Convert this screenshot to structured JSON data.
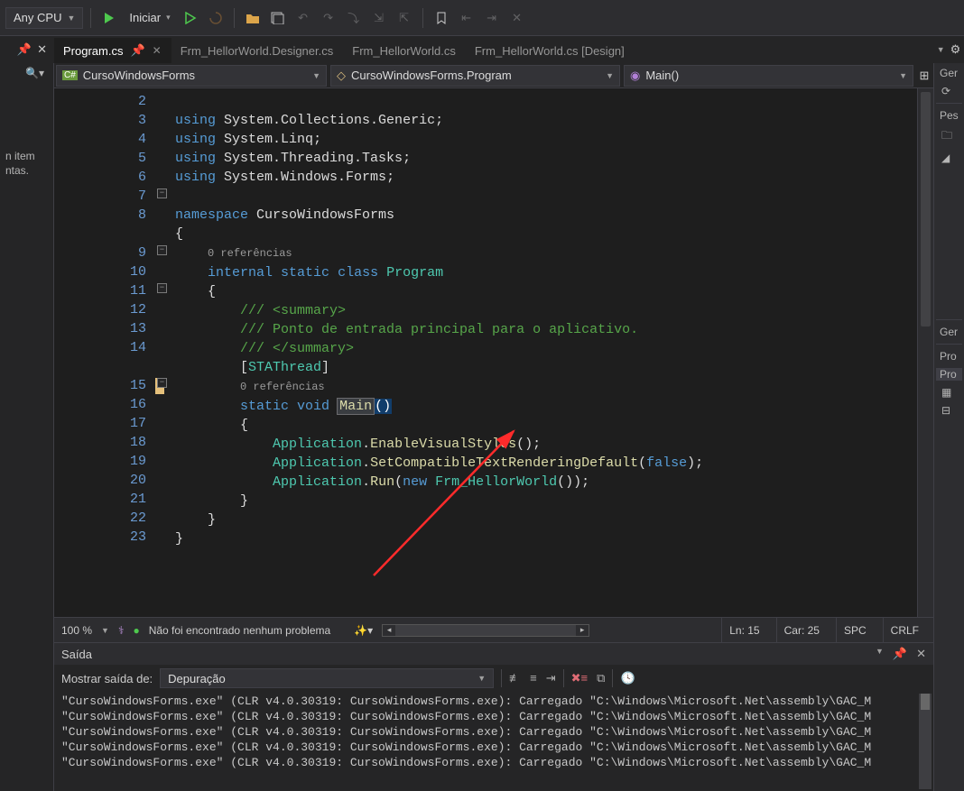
{
  "toolbar": {
    "config": "Any CPU",
    "start_label": "Iniciar"
  },
  "tabs": {
    "t0": "Program.cs",
    "t1": "Frm_HellorWorld.Designer.cs",
    "t2": "Frm_HellorWorld.cs",
    "t3": "Frm_HellorWorld.cs [Design]"
  },
  "nav": {
    "project": "CursoWindowsForms",
    "class": "CursoWindowsForms.Program",
    "member": "Main()"
  },
  "left_hint": "n item ntas.",
  "right": {
    "r0": "Ger",
    "r1": "Pes",
    "r2": "Ger",
    "r3": "Pro",
    "r4": "Pro"
  },
  "code": {
    "ref0": "0 referências",
    "ref1": "0 referências",
    "lines": {
      "l2": "System.Collections.Generic",
      "l3": "System.Linq",
      "l4": "System.Threading.Tasks",
      "l5": "System.Windows.Forms",
      "ns": "CursoWindowsForms",
      "cls": "Program",
      "c1": "/// <summary>",
      "c2": "/// Ponto de entrada principal para o aplicativo.",
      "c3": "/// </summary>",
      "attr": "STAThread",
      "m1": "EnableVisualStyles",
      "m2": "SetCompatibleTextRenderingDefault",
      "m3": "Run",
      "frm": "Frm_HellorWorld"
    },
    "line_numbers": [
      "2",
      "3",
      "4",
      "5",
      "6",
      "7",
      "8",
      "",
      "9",
      "10",
      "11",
      "12",
      "13",
      "14",
      "",
      "15",
      "16",
      "17",
      "18",
      "19",
      "20",
      "21",
      "22",
      "23"
    ]
  },
  "status": {
    "zoom": "100 %",
    "issues": "Não foi encontrado nenhum problema",
    "ln": "Ln: 15",
    "col": "Car: 25",
    "ins": "SPC",
    "eol": "CRLF"
  },
  "output": {
    "title": "Saída",
    "from_label": "Mostrar saída de:",
    "source": "Depuração",
    "line_tpl": "\"CursoWindowsForms.exe\" (CLR v4.0.30319: CursoWindowsForms.exe): Carregado \"C:\\Windows\\Microsoft.Net\\assembly\\GAC_M"
  }
}
